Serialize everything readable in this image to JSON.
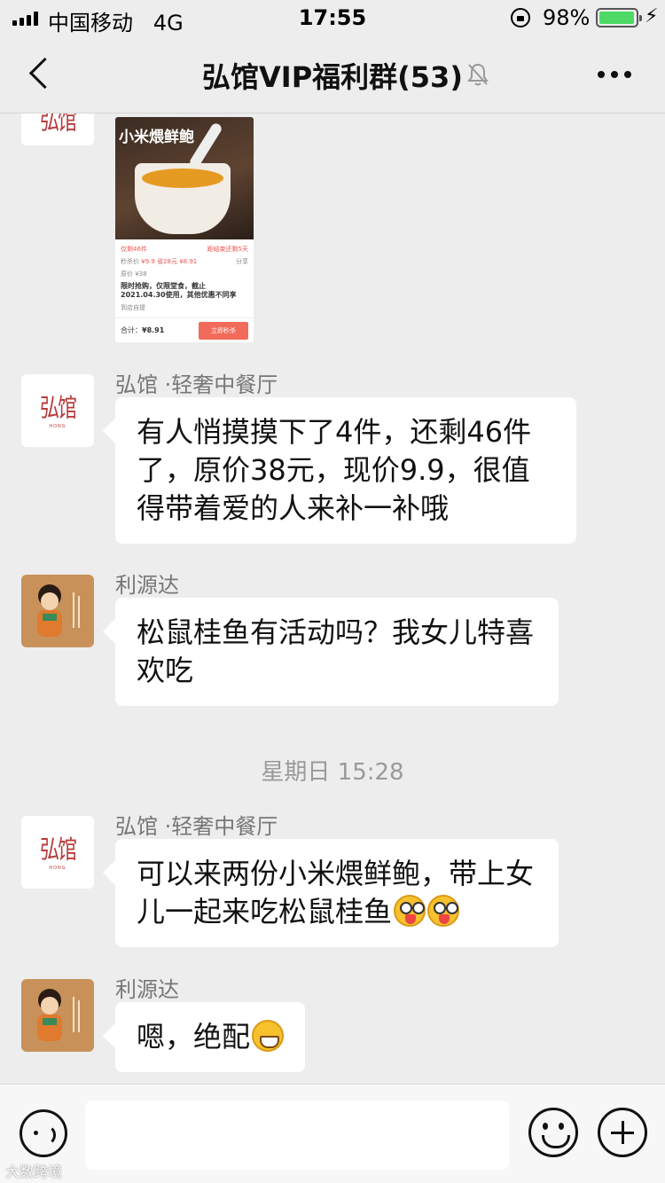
{
  "status_bar": {
    "carrier": "中国移动",
    "network": "4G",
    "time": "17:55",
    "battery_percent": "98%",
    "battery_level": 0.98,
    "battery_color": "#4cd964"
  },
  "nav": {
    "title": "弘馆VIP福利群(53)",
    "back_icon": "chevron-left-icon",
    "mute_icon": "bell-muted-icon",
    "more_icon": "more-dots-icon"
  },
  "product_card": {
    "title": "小米煨鲜鲍",
    "stock_left": "仅剩46件",
    "countdown_label": "距结束还剩5天",
    "price_label": "秒杀价",
    "price": "¥9.9",
    "coupon": "省28元 ¥8.91",
    "original_price": "原价 ¥38",
    "description": "限时抢购，仅限堂食，截止2021.04.30使用，其他优惠不同享",
    "store_pickup": "到店自提",
    "total_label": "合计：",
    "total_value": "¥8.91",
    "buy_label": "立即秒杀",
    "share_label": "分享"
  },
  "messages": [
    {
      "sender": "弘馆 ·轻奢中餐厅",
      "text": "有人悄摸摸下了4件，还剩46件了，原价38元，现价9.9，很值得带着爱的人来补一补哦"
    },
    {
      "sender": "利源达",
      "text": "松鼠桂鱼有活动吗？我女儿特喜欢吃"
    },
    {
      "sender": "弘馆 ·轻奢中餐厅",
      "text": "可以来两份小米煨鲜鲍，带上女儿一起来吃松鼠桂鱼"
    },
    {
      "sender": "利源达",
      "text": "嗯，绝配"
    }
  ],
  "timestamp": "星期日 15:28",
  "input_bar": {
    "voice_icon": "voice-icon",
    "emoji_icon": "emoji-icon",
    "plus_icon": "plus-icon",
    "placeholder": ""
  },
  "watermark": "大数跨境",
  "colors": {
    "background": "#ededed",
    "bubble": "#ffffff",
    "brand_red": "#b83a3a",
    "buy_button": "#f26a5a"
  }
}
